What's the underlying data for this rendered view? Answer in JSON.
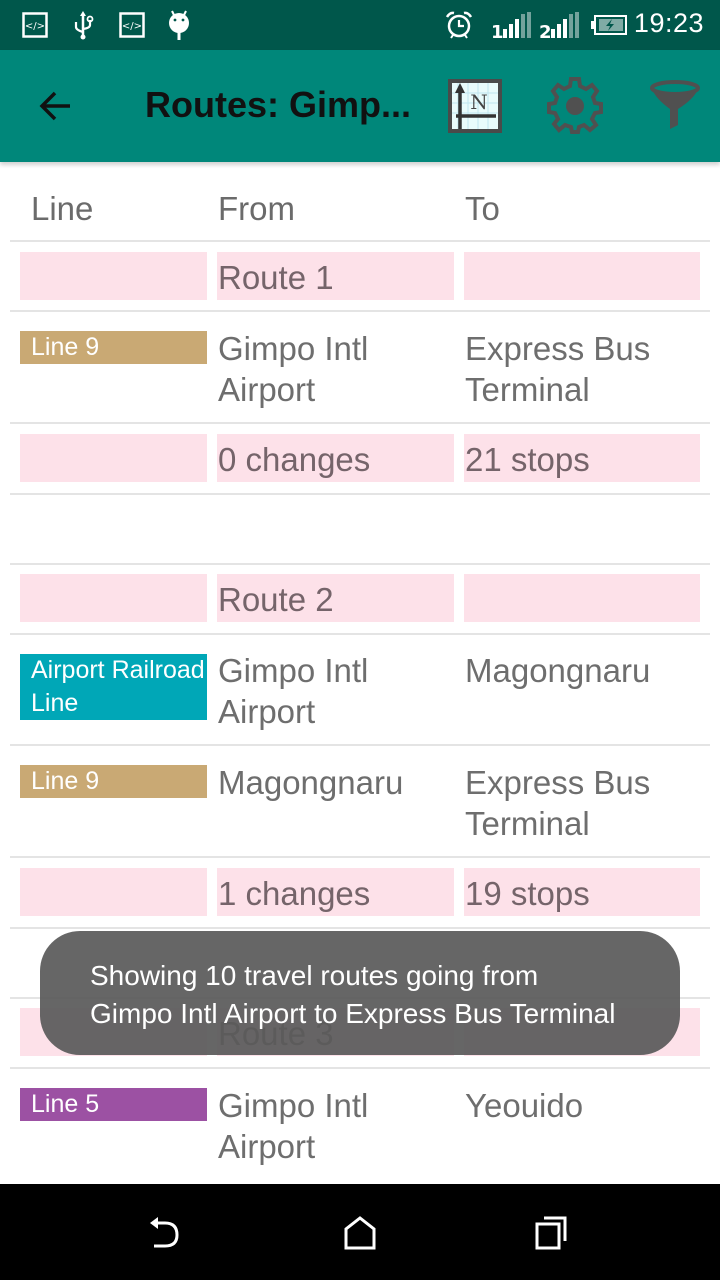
{
  "status_bar": {
    "time": "19:23",
    "left_icons": [
      "code-icon",
      "usb-icon",
      "code-icon",
      "android-debug-icon"
    ],
    "right_icons": [
      "alarm-icon",
      "signal-sim1-icon",
      "signal-sim2-icon",
      "battery-charging-icon"
    ],
    "sim1_label": "1",
    "sim2_label": "2"
  },
  "app_bar": {
    "title": "Routes: Gimp...",
    "back_icon": "arrow-left-icon",
    "actions": [
      {
        "name": "north-up-toggle",
        "icon": "north-up-icon"
      },
      {
        "name": "settings",
        "icon": "gear-icon"
      },
      {
        "name": "filter",
        "icon": "funnel-icon"
      }
    ],
    "color": "#00877a"
  },
  "table": {
    "headers": {
      "line": "Line",
      "from": "From",
      "to": "To"
    },
    "rows": [
      {
        "type": "route-header",
        "from": "Route 1",
        "to": ""
      },
      {
        "type": "segment",
        "line": "Line 9",
        "line_color": "#c9a974",
        "from": "Gimpo Intl Airport",
        "to": "Express Bus Terminal"
      },
      {
        "type": "summary",
        "from": "0 changes",
        "to": "21 stops"
      },
      {
        "type": "spacer"
      },
      {
        "type": "route-header",
        "from": "Route 2",
        "to": ""
      },
      {
        "type": "segment",
        "line": "Airport Railroad Line",
        "line_color": "#00a7b7",
        "from": "Gimpo Intl Airport",
        "to": "Magongnaru"
      },
      {
        "type": "segment",
        "line": "Line 9",
        "line_color": "#c9a974",
        "from": "Magongnaru",
        "to": "Express Bus Terminal"
      },
      {
        "type": "summary",
        "from": "1 changes",
        "to": "19 stops"
      },
      {
        "type": "spacer"
      },
      {
        "type": "route-header",
        "from": "Route 3",
        "to": ""
      },
      {
        "type": "segment",
        "line": "Line 5",
        "line_color": "#9c51a3",
        "from": "Gimpo Intl Airport",
        "to": "Yeouido"
      }
    ]
  },
  "toast": {
    "line1": "Showing 10 travel routes going from",
    "line2": "Gimpo Intl Airport to Express Bus Terminal"
  },
  "nav_bar": {
    "buttons": [
      "back-icon",
      "home-icon",
      "recents-icon"
    ]
  }
}
